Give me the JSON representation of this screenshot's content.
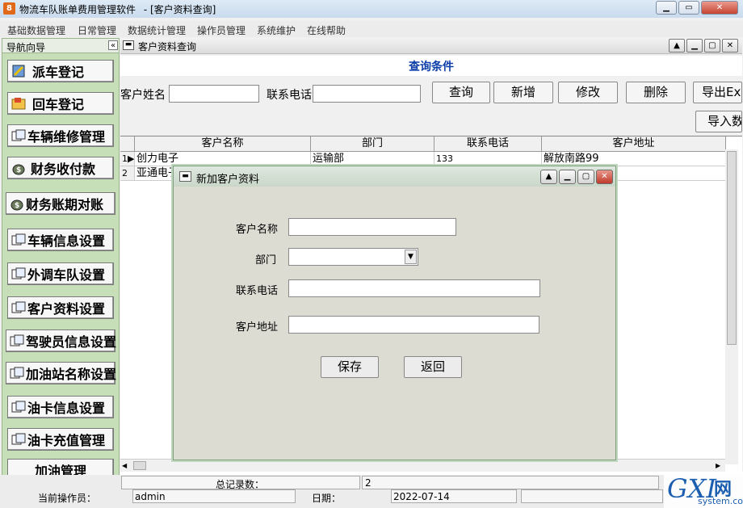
{
  "app": {
    "title": "物流车队账单费用管理软件",
    "window_label": "- [客户资料查询]",
    "icon_text": "8"
  },
  "window_controls": {
    "restore": "▫",
    "maximize": "▢",
    "close": "✕"
  },
  "menu": [
    "基础数据管理",
    "日常管理",
    "数据统计管理",
    "操作员管理",
    "系统维护",
    "在线帮助"
  ],
  "nav": {
    "title": "导航向导",
    "collapse": "«",
    "items": [
      {
        "label": "派车登记",
        "icon": "car-dispatch-icon"
      },
      {
        "label": "回车登记",
        "icon": "folder-icon"
      },
      {
        "label": "车辆维修管理",
        "icon": "form-icon"
      },
      {
        "label": "财务收付款",
        "icon": "money-bag-icon"
      },
      {
        "label": "财务账期对账",
        "icon": "money-bag-icon"
      },
      {
        "label": "车辆信息设置",
        "icon": "form-icon"
      },
      {
        "label": "外调车队设置",
        "icon": "form-icon"
      },
      {
        "label": "客户资料设置",
        "icon": "form-icon"
      },
      {
        "label": "驾驶员信息设置",
        "icon": "form-icon"
      },
      {
        "label": "加油站名称设置",
        "icon": "form-icon"
      },
      {
        "label": "油卡信息设置",
        "icon": "form-icon"
      },
      {
        "label": "油卡充值管理",
        "icon": "form-icon"
      },
      {
        "label": "加油管理",
        "icon": ""
      }
    ]
  },
  "child_window": {
    "title": "客户资料查询",
    "query_title": "查询条件",
    "customer_name_label": "客户姓名",
    "customer_name_value": "",
    "phone_label": "联系电话",
    "phone_value": "",
    "buttons": {
      "query": "查询",
      "add": "新增",
      "edit": "修改",
      "delete": "删除",
      "export": "导出Ex",
      "import": "导入数"
    }
  },
  "grid": {
    "columns": [
      "客户名称",
      "部门",
      "联系电话",
      "客户地址"
    ],
    "rows": [
      {
        "no": "1",
        "indicator": "▶",
        "name": "创力电子",
        "dept": "运输部",
        "phone": "133",
        "address": "解放南路99"
      },
      {
        "no": "2",
        "indicator": "",
        "name": "亚通电子",
        "dept": "",
        "phone": "",
        "address": ""
      }
    ]
  },
  "dialog": {
    "title": "新加客户资料",
    "fields": {
      "name_label": "客户名称",
      "name_value": "",
      "dept_label": "部门",
      "dept_value": "",
      "phone_label": "联系电话",
      "phone_value": "",
      "address_label": "客户地址",
      "address_value": ""
    },
    "save": "保存",
    "back": "返回"
  },
  "status": {
    "total_label": "总记录数：",
    "total_value": "2",
    "operator_label": "当前操作员：",
    "operator_value": "admin",
    "date_label": "日期：",
    "date_value": "2022-07-14"
  },
  "watermark": {
    "logo": "GXI",
    "cn": "网",
    "sub": "system.com"
  },
  "colors": {
    "nav_bg": "#c6dfb8",
    "query_title": "#0b3ea8",
    "dialog_bg": "#dcdcd3",
    "close_red": "#c64431"
  }
}
